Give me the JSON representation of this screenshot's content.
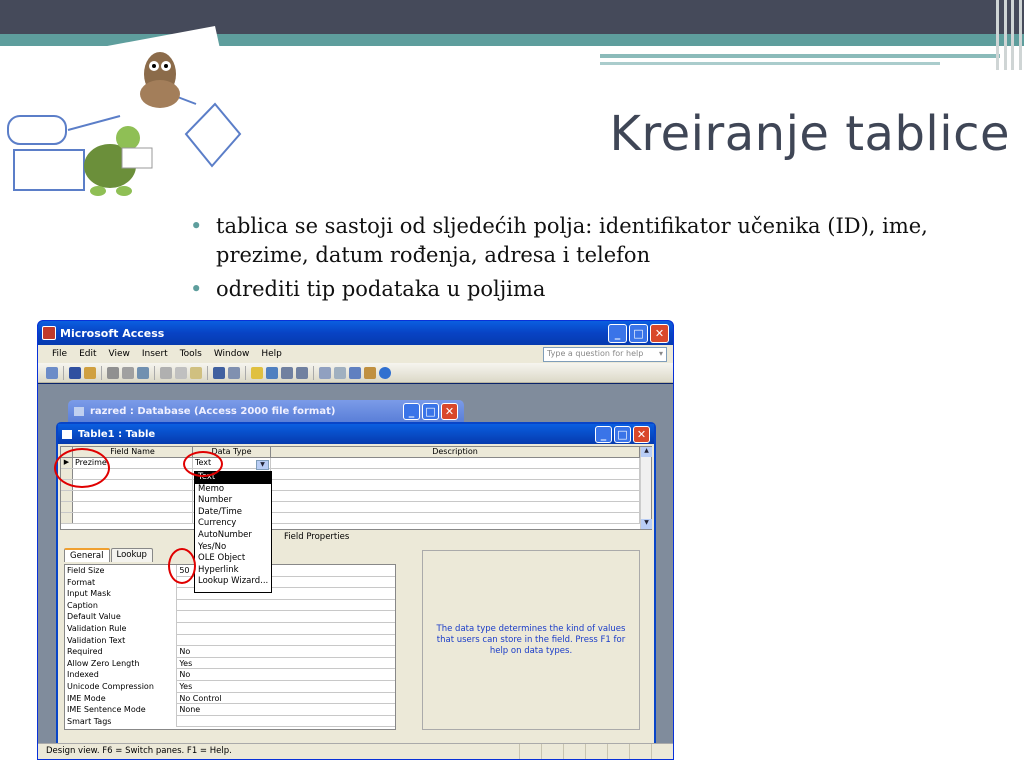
{
  "slide": {
    "title": "Kreiranje tablice",
    "bullets": [
      "tablica se sastoji od sljedećih polja: identifikator učenika (ID), ime, prezime, datum rođenja, adresa i telefon",
      "odrediti tip podataka u poljima"
    ]
  },
  "app": {
    "title": "Microsoft Access",
    "menu": [
      "File",
      "Edit",
      "View",
      "Insert",
      "Tools",
      "Window",
      "Help"
    ],
    "help_placeholder": "Type a question for help",
    "db_window_title": "razred : Database (Access 2000 file format)",
    "table_window_title": "Table1 : Table",
    "columns": [
      "Field Name",
      "Data Type",
      "Description"
    ],
    "row": {
      "field_name": "Prezime",
      "data_type": "Text"
    },
    "data_type_options": [
      "Text",
      "Memo",
      "Number",
      "Date/Time",
      "Currency",
      "AutoNumber",
      "Yes/No",
      "OLE Object",
      "Hyperlink",
      "Lookup Wizard..."
    ],
    "selected_option": "Text",
    "field_properties_label": "Field Properties",
    "tabs": [
      "General",
      "Lookup"
    ],
    "properties": [
      {
        "name": "Field Size",
        "value": "50"
      },
      {
        "name": "Format",
        "value": ""
      },
      {
        "name": "Input Mask",
        "value": ""
      },
      {
        "name": "Caption",
        "value": ""
      },
      {
        "name": "Default Value",
        "value": ""
      },
      {
        "name": "Validation Rule",
        "value": ""
      },
      {
        "name": "Validation Text",
        "value": ""
      },
      {
        "name": "Required",
        "value": "No"
      },
      {
        "name": "Allow Zero Length",
        "value": "Yes"
      },
      {
        "name": "Indexed",
        "value": "No"
      },
      {
        "name": "Unicode Compression",
        "value": "Yes"
      },
      {
        "name": "IME Mode",
        "value": "No Control"
      },
      {
        "name": "IME Sentence Mode",
        "value": "None"
      },
      {
        "name": "Smart Tags",
        "value": ""
      }
    ],
    "help_text": "The data type determines the kind of values that users can store in the field.  Press F1 for help on data types.",
    "status": "Design view.  F6 = Switch panes.  F1 = Help."
  },
  "colors": {
    "title_text": "#3f4656",
    "band_dark": "#454a5a",
    "band_teal": "#5e9e9d",
    "annotation_red": "#e00000"
  }
}
